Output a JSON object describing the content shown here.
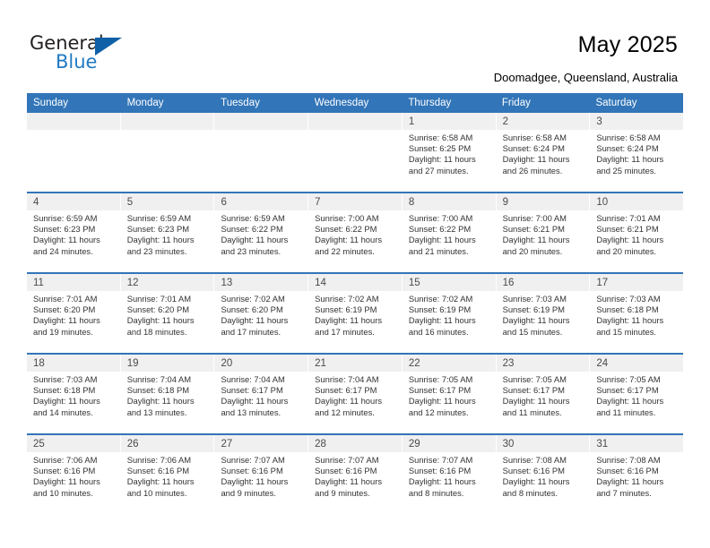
{
  "brand": {
    "name_part1": "General",
    "name_part2": "Blue",
    "triangle_color": "#1060a8",
    "blue_color": "#1f7ac4"
  },
  "header": {
    "title": "May 2025",
    "subtitle": "Doomadgee, Queensland, Australia"
  },
  "theme": {
    "header_blue": "#3275b8",
    "daynum_band": "#f0f0f0"
  },
  "weekdays": [
    "Sunday",
    "Monday",
    "Tuesday",
    "Wednesday",
    "Thursday",
    "Friday",
    "Saturday"
  ],
  "weeks": [
    [
      {
        "day": "",
        "empty": true,
        "sunrise": "",
        "sunset": "",
        "daylight_line1": "",
        "daylight_line2": ""
      },
      {
        "day": "",
        "empty": true,
        "sunrise": "",
        "sunset": "",
        "daylight_line1": "",
        "daylight_line2": ""
      },
      {
        "day": "",
        "empty": true,
        "sunrise": "",
        "sunset": "",
        "daylight_line1": "",
        "daylight_line2": ""
      },
      {
        "day": "",
        "empty": true,
        "sunrise": "",
        "sunset": "",
        "daylight_line1": "",
        "daylight_line2": ""
      },
      {
        "day": "1",
        "empty": false,
        "sunrise": "Sunrise: 6:58 AM",
        "sunset": "Sunset: 6:25 PM",
        "daylight_line1": "Daylight: 11 hours",
        "daylight_line2": "and 27 minutes."
      },
      {
        "day": "2",
        "empty": false,
        "sunrise": "Sunrise: 6:58 AM",
        "sunset": "Sunset: 6:24 PM",
        "daylight_line1": "Daylight: 11 hours",
        "daylight_line2": "and 26 minutes."
      },
      {
        "day": "3",
        "empty": false,
        "sunrise": "Sunrise: 6:58 AM",
        "sunset": "Sunset: 6:24 PM",
        "daylight_line1": "Daylight: 11 hours",
        "daylight_line2": "and 25 minutes."
      }
    ],
    [
      {
        "day": "4",
        "empty": false,
        "sunrise": "Sunrise: 6:59 AM",
        "sunset": "Sunset: 6:23 PM",
        "daylight_line1": "Daylight: 11 hours",
        "daylight_line2": "and 24 minutes."
      },
      {
        "day": "5",
        "empty": false,
        "sunrise": "Sunrise: 6:59 AM",
        "sunset": "Sunset: 6:23 PM",
        "daylight_line1": "Daylight: 11 hours",
        "daylight_line2": "and 23 minutes."
      },
      {
        "day": "6",
        "empty": false,
        "sunrise": "Sunrise: 6:59 AM",
        "sunset": "Sunset: 6:22 PM",
        "daylight_line1": "Daylight: 11 hours",
        "daylight_line2": "and 23 minutes."
      },
      {
        "day": "7",
        "empty": false,
        "sunrise": "Sunrise: 7:00 AM",
        "sunset": "Sunset: 6:22 PM",
        "daylight_line1": "Daylight: 11 hours",
        "daylight_line2": "and 22 minutes."
      },
      {
        "day": "8",
        "empty": false,
        "sunrise": "Sunrise: 7:00 AM",
        "sunset": "Sunset: 6:22 PM",
        "daylight_line1": "Daylight: 11 hours",
        "daylight_line2": "and 21 minutes."
      },
      {
        "day": "9",
        "empty": false,
        "sunrise": "Sunrise: 7:00 AM",
        "sunset": "Sunset: 6:21 PM",
        "daylight_line1": "Daylight: 11 hours",
        "daylight_line2": "and 20 minutes."
      },
      {
        "day": "10",
        "empty": false,
        "sunrise": "Sunrise: 7:01 AM",
        "sunset": "Sunset: 6:21 PM",
        "daylight_line1": "Daylight: 11 hours",
        "daylight_line2": "and 20 minutes."
      }
    ],
    [
      {
        "day": "11",
        "empty": false,
        "sunrise": "Sunrise: 7:01 AM",
        "sunset": "Sunset: 6:20 PM",
        "daylight_line1": "Daylight: 11 hours",
        "daylight_line2": "and 19 minutes."
      },
      {
        "day": "12",
        "empty": false,
        "sunrise": "Sunrise: 7:01 AM",
        "sunset": "Sunset: 6:20 PM",
        "daylight_line1": "Daylight: 11 hours",
        "daylight_line2": "and 18 minutes."
      },
      {
        "day": "13",
        "empty": false,
        "sunrise": "Sunrise: 7:02 AM",
        "sunset": "Sunset: 6:20 PM",
        "daylight_line1": "Daylight: 11 hours",
        "daylight_line2": "and 17 minutes."
      },
      {
        "day": "14",
        "empty": false,
        "sunrise": "Sunrise: 7:02 AM",
        "sunset": "Sunset: 6:19 PM",
        "daylight_line1": "Daylight: 11 hours",
        "daylight_line2": "and 17 minutes."
      },
      {
        "day": "15",
        "empty": false,
        "sunrise": "Sunrise: 7:02 AM",
        "sunset": "Sunset: 6:19 PM",
        "daylight_line1": "Daylight: 11 hours",
        "daylight_line2": "and 16 minutes."
      },
      {
        "day": "16",
        "empty": false,
        "sunrise": "Sunrise: 7:03 AM",
        "sunset": "Sunset: 6:19 PM",
        "daylight_line1": "Daylight: 11 hours",
        "daylight_line2": "and 15 minutes."
      },
      {
        "day": "17",
        "empty": false,
        "sunrise": "Sunrise: 7:03 AM",
        "sunset": "Sunset: 6:18 PM",
        "daylight_line1": "Daylight: 11 hours",
        "daylight_line2": "and 15 minutes."
      }
    ],
    [
      {
        "day": "18",
        "empty": false,
        "sunrise": "Sunrise: 7:03 AM",
        "sunset": "Sunset: 6:18 PM",
        "daylight_line1": "Daylight: 11 hours",
        "daylight_line2": "and 14 minutes."
      },
      {
        "day": "19",
        "empty": false,
        "sunrise": "Sunrise: 7:04 AM",
        "sunset": "Sunset: 6:18 PM",
        "daylight_line1": "Daylight: 11 hours",
        "daylight_line2": "and 13 minutes."
      },
      {
        "day": "20",
        "empty": false,
        "sunrise": "Sunrise: 7:04 AM",
        "sunset": "Sunset: 6:17 PM",
        "daylight_line1": "Daylight: 11 hours",
        "daylight_line2": "and 13 minutes."
      },
      {
        "day": "21",
        "empty": false,
        "sunrise": "Sunrise: 7:04 AM",
        "sunset": "Sunset: 6:17 PM",
        "daylight_line1": "Daylight: 11 hours",
        "daylight_line2": "and 12 minutes."
      },
      {
        "day": "22",
        "empty": false,
        "sunrise": "Sunrise: 7:05 AM",
        "sunset": "Sunset: 6:17 PM",
        "daylight_line1": "Daylight: 11 hours",
        "daylight_line2": "and 12 minutes."
      },
      {
        "day": "23",
        "empty": false,
        "sunrise": "Sunrise: 7:05 AM",
        "sunset": "Sunset: 6:17 PM",
        "daylight_line1": "Daylight: 11 hours",
        "daylight_line2": "and 11 minutes."
      },
      {
        "day": "24",
        "empty": false,
        "sunrise": "Sunrise: 7:05 AM",
        "sunset": "Sunset: 6:17 PM",
        "daylight_line1": "Daylight: 11 hours",
        "daylight_line2": "and 11 minutes."
      }
    ],
    [
      {
        "day": "25",
        "empty": false,
        "sunrise": "Sunrise: 7:06 AM",
        "sunset": "Sunset: 6:16 PM",
        "daylight_line1": "Daylight: 11 hours",
        "daylight_line2": "and 10 minutes."
      },
      {
        "day": "26",
        "empty": false,
        "sunrise": "Sunrise: 7:06 AM",
        "sunset": "Sunset: 6:16 PM",
        "daylight_line1": "Daylight: 11 hours",
        "daylight_line2": "and 10 minutes."
      },
      {
        "day": "27",
        "empty": false,
        "sunrise": "Sunrise: 7:07 AM",
        "sunset": "Sunset: 6:16 PM",
        "daylight_line1": "Daylight: 11 hours",
        "daylight_line2": "and 9 minutes."
      },
      {
        "day": "28",
        "empty": false,
        "sunrise": "Sunrise: 7:07 AM",
        "sunset": "Sunset: 6:16 PM",
        "daylight_line1": "Daylight: 11 hours",
        "daylight_line2": "and 9 minutes."
      },
      {
        "day": "29",
        "empty": false,
        "sunrise": "Sunrise: 7:07 AM",
        "sunset": "Sunset: 6:16 PM",
        "daylight_line1": "Daylight: 11 hours",
        "daylight_line2": "and 8 minutes."
      },
      {
        "day": "30",
        "empty": false,
        "sunrise": "Sunrise: 7:08 AM",
        "sunset": "Sunset: 6:16 PM",
        "daylight_line1": "Daylight: 11 hours",
        "daylight_line2": "and 8 minutes."
      },
      {
        "day": "31",
        "empty": false,
        "sunrise": "Sunrise: 7:08 AM",
        "sunset": "Sunset: 6:16 PM",
        "daylight_line1": "Daylight: 11 hours",
        "daylight_line2": "and 7 minutes."
      }
    ]
  ]
}
